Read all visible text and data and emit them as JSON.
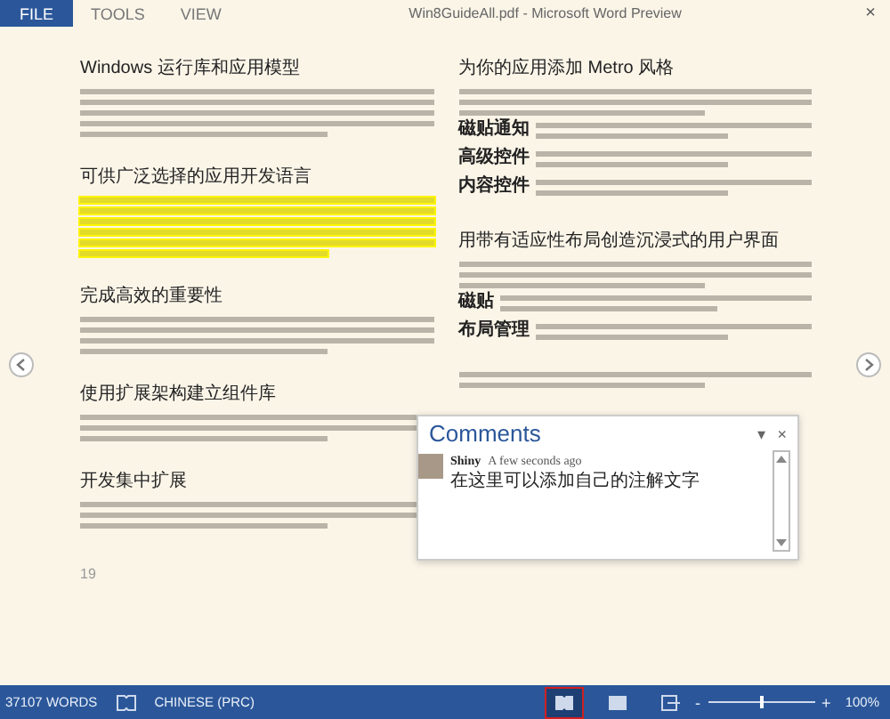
{
  "menu": [
    {
      "label": "FILE",
      "selected": true
    },
    {
      "label": "TOOLS",
      "selected": false
    },
    {
      "label": "VIEW",
      "selected": false
    }
  ],
  "window": {
    "title": "Win8GuideAll.pdf - Microsoft Word Preview",
    "close": "×"
  },
  "left_column": [
    {
      "heading": "Windows 运行库和应用模型",
      "highlighted": false
    },
    {
      "heading": "可供广泛选择的应用开发语言",
      "highlighted": true
    },
    {
      "heading": "完成高效的重要性",
      "highlighted": false
    },
    {
      "heading": "使用扩展架构建立组件库",
      "highlighted": false
    },
    {
      "heading": "开发集中扩展",
      "highlighted": false
    }
  ],
  "page_number": "19",
  "right_column": [
    {
      "heading": "为你的应用添加 Metro 风格",
      "items": [
        {
          "label": "磁贴通知"
        },
        {
          "label": "高级控件"
        },
        {
          "label": "内容控件"
        }
      ]
    },
    {
      "heading": "用带有适应性布局创造沉浸式的用户界面",
      "items": [
        {
          "label": "磁贴"
        },
        {
          "label": "布局管理"
        }
      ]
    }
  ],
  "comments": {
    "title": "Comments",
    "menu": "▾",
    "close": "×",
    "entries": [
      {
        "author": "Shiny",
        "time": "A few seconds ago",
        "text": "在这里可以添加自己的注解文字"
      }
    ]
  },
  "status_bar": {
    "words": "37107 WORDS",
    "language": "CHINESE (PRC)",
    "views": [
      {
        "selected": true
      },
      {
        "selected": false
      },
      {
        "selected": false
      }
    ],
    "zoom_out": "-",
    "zoom_in": "+",
    "zoom": {
      "level": 0.5
    },
    "zoom_text": "100%"
  }
}
